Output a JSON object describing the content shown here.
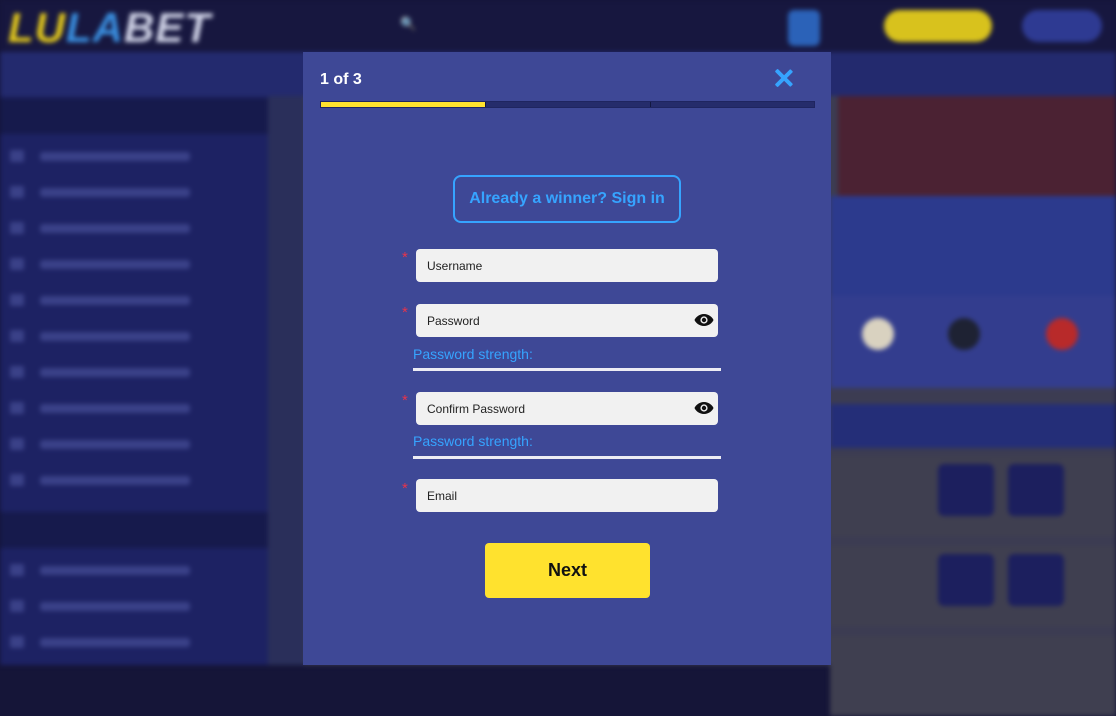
{
  "site": {
    "logo": "LULABET",
    "logo_parts": [
      "LU",
      "LA",
      "BET"
    ]
  },
  "modal": {
    "step": "1 of 3",
    "progress": {
      "current_step": 1,
      "total_steps": 3
    },
    "close_icon": "close-icon",
    "signin_label": "Already a winner? Sign in",
    "fields": {
      "username": {
        "placeholder": "Username",
        "required": true
      },
      "password": {
        "placeholder": "Password",
        "required": true,
        "strength_label": "Password strength:"
      },
      "confirm_password": {
        "placeholder": "Confirm Password",
        "required": true,
        "strength_label": "Password strength:"
      },
      "email": {
        "placeholder": "Email",
        "required": true
      }
    },
    "required_marker": "*",
    "next_label": "Next"
  },
  "colors": {
    "modal_bg": "#3e4896",
    "accent_blue": "#36a4ff",
    "accent_yellow": "#ffe22e",
    "required_red": "#e8344b"
  }
}
